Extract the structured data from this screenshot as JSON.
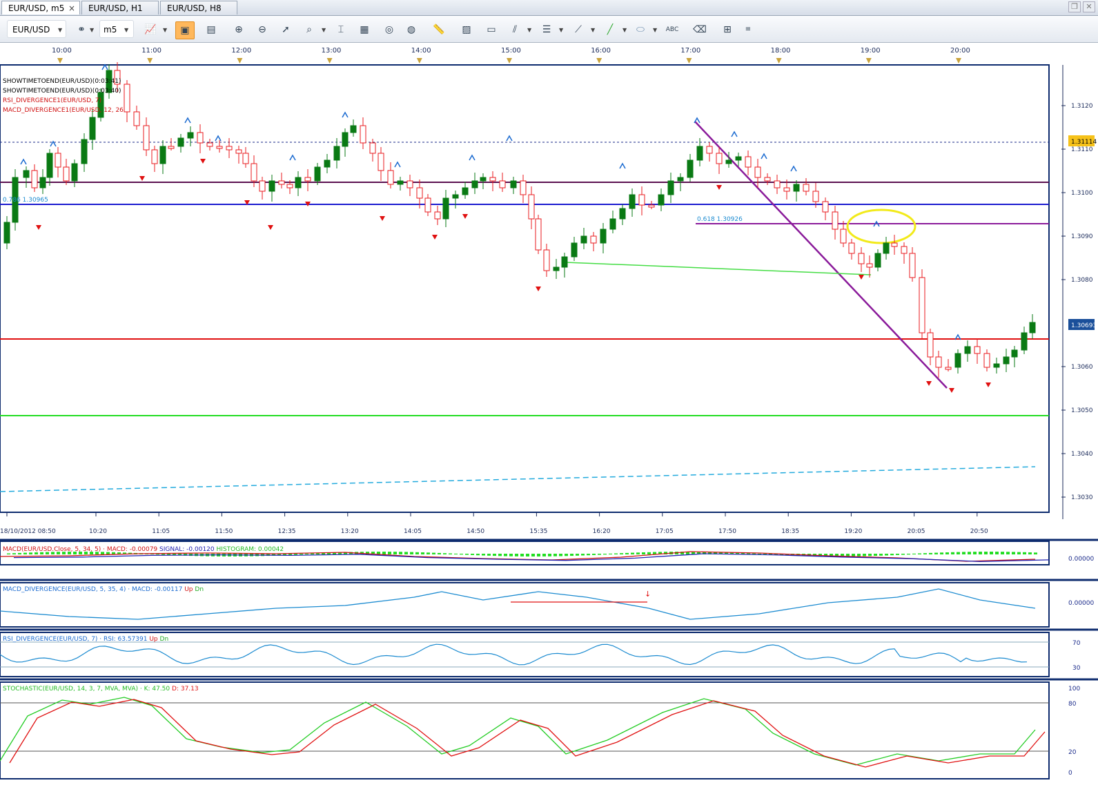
{
  "tabs": [
    {
      "label": "EUR/USD, m5",
      "close": "×"
    },
    {
      "label": "EUR/USD, H1"
    },
    {
      "label": "EUR/USD, H8"
    }
  ],
  "toolbar": {
    "symbol": "EUR/USD",
    "period": "m5"
  },
  "main_chart": {
    "top_time_labels": [
      "10:00",
      "11:00",
      "12:00",
      "13:00",
      "14:00",
      "15:00",
      "16:00",
      "17:00",
      "18:00",
      "19:00",
      "20:00"
    ],
    "bottom_time_labels": [
      "18/10/2012 08:50",
      "10:20",
      "11:05",
      "11:50",
      "12:35",
      "13:20",
      "14:05",
      "14:50",
      "15:35",
      "16:20",
      "17:05",
      "17:50",
      "18:35",
      "19:20",
      "20:05",
      "20:50"
    ],
    "price_ticks": [
      "1.3120",
      "1.3110",
      "1.3100",
      "1.3090",
      "1.3080",
      "1.3060",
      "1.3050",
      "1.3040",
      "1.3030"
    ],
    "price_marker_yellow": "1.31114",
    "price_marker_blue": "1.30693",
    "legend": [
      "SHOWTIMETOEND(EUR/USD)(0:03:41)",
      "SHOWTIMETOEND(EUR/USD)(0:03:40)",
      "RSI_DIVERGENCE1(EUR/USD, 7)",
      "MACD_DIVERGENCE1(EUR/USD, 12, 26"
    ],
    "fib_label_078": "0.786 1.30965",
    "fib_label_0618": "0.618 1.30926"
  },
  "macd_panel": {
    "label_a": "MACD(EUR/USD.Close, 5, 34, 5) · MACD: -0.00079",
    "label_b": "SIGNAL: -0.00120",
    "label_c": "HISTOGRAM: 0.00042",
    "scale": "0.00000"
  },
  "macd_div_panel": {
    "label_a": "MACD_DIVERGENCE(EUR/USD, 5, 35, 4) · MACD: -0.00117",
    "label_up": "Up",
    "label_dn": "Dn",
    "scale": "0.00000"
  },
  "rsi_panel": {
    "label_a": "RSI_DIVERGENCE(EUR/USD, 7) · RSI: 63.57391",
    "label_up": "Up",
    "label_dn": "Dn",
    "scale_top": "70",
    "scale_bottom": "30"
  },
  "stoch_panel": {
    "label_a": "STOCHASTIC(EUR/USD, 14, 3, 7, MVA, MVA) · K: 47.50",
    "label_b": "D: 37.13",
    "scale": [
      "100",
      "80",
      "20",
      "0"
    ]
  },
  "colors": {
    "bull": "#0a7a14",
    "bear": "#e8191c",
    "resistance": "#5b1050",
    "support_blue": "#1a1ad0",
    "fib": "#8a1a9a",
    "red_line": "#e01010",
    "green_line": "#22dd22",
    "dashed": "#22aadd",
    "yellow": "#f2ea1a"
  }
}
